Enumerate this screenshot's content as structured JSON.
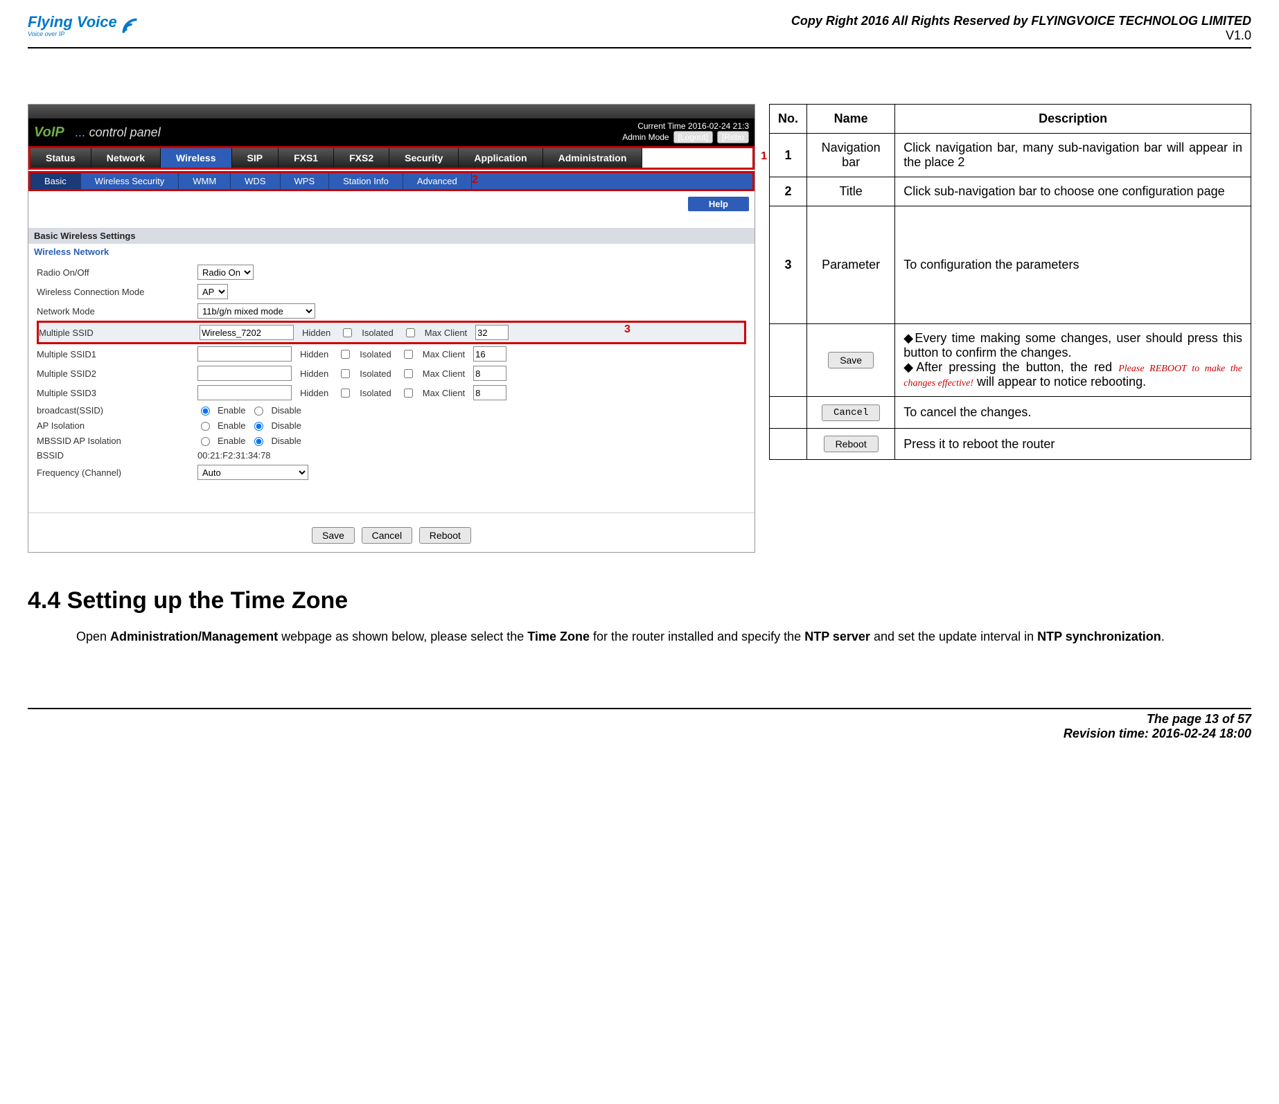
{
  "header": {
    "logo_text": "Flying Voice",
    "logo_sub": "Voice over IP",
    "copyright": "Copy Right 2016 All Rights Reserved by FLYINGVOICE TECHNOLOG LIMITED",
    "version": "V1.0"
  },
  "router": {
    "voip_label": "VoIP",
    "control_panel": "control panel",
    "current_time_label": "Current Time",
    "current_time_value": "2016-02-24 21:3",
    "admin_mode": "Admin Mode",
    "logout": "[Logout]",
    "reboot_top": "[Rebo",
    "nav1": [
      "Status",
      "Network",
      "Wireless",
      "SIP",
      "FXS1",
      "FXS2",
      "Security",
      "Application",
      "Administration"
    ],
    "nav1_active": "Wireless",
    "nav2": [
      "Basic",
      "Wireless Security",
      "WMM",
      "WDS",
      "WPS",
      "Station Info",
      "Advanced"
    ],
    "nav2_active": "Basic",
    "help": "Help",
    "section_title": "Basic Wireless Settings",
    "section_sub": "Wireless Network",
    "markers": {
      "m1": "1",
      "m2": "2",
      "m3": "3"
    },
    "fields": {
      "radio_label": "Radio On/Off",
      "radio_sel": "Radio On",
      "wcm_label": "Wireless Connection Mode",
      "wcm_sel": "AP",
      "nm_label": "Network Mode",
      "nm_sel": "11b/g/n mixed mode",
      "mssid_label": "Multiple SSID",
      "mssid_val": "Wireless_7202",
      "hidden": "Hidden",
      "isolated": "Isolated",
      "maxclient": "Max Client",
      "mssid_mc": "32",
      "mssid1_label": "Multiple SSID1",
      "mssid1_mc": "16",
      "mssid2_label": "Multiple SSID2",
      "mssid2_mc": "8",
      "mssid3_label": "Multiple SSID3",
      "mssid3_mc": "8",
      "broadcast_label": "broadcast(SSID)",
      "enable": "Enable",
      "disable": "Disable",
      "apiso_label": "AP Isolation",
      "mbssid_label": "MBSSID AP Isolation",
      "bssid_label": "BSSID",
      "bssid_val": "00:21:F2:31:34:78",
      "freq_label": "Frequency (Channel)",
      "freq_sel": "Auto"
    },
    "footer": {
      "save": "Save",
      "cancel": "Cancel",
      "reboot": "Reboot"
    }
  },
  "desc_table": {
    "hdr_no": "No.",
    "hdr_name": "Name",
    "hdr_desc": "Description",
    "r1_no": "1",
    "r1_name": "Navigation bar",
    "r1_desc": "Click navigation bar, many sub-navigation bar will appear in the place 2",
    "r2_no": "2",
    "r2_name": "Title",
    "r2_desc": "Click sub-navigation bar to choose one configuration page",
    "r3_no": "3",
    "r3_name": "Parameter",
    "r3_desc": "To configuration the parameters",
    "r4_btn": "Save",
    "r4_d1": "Every time making some changes, user should press this button to confirm the changes.",
    "r4_d2a": "After pressing the button, the red",
    "r4_red": "Please REBOOT to make the changes effective!",
    "r4_d2b": "will appear to notice rebooting.",
    "r5_btn": "Cancel",
    "r5_desc": "To cancel the changes.",
    "r6_btn": "Reboot",
    "r6_desc": "Press it to reboot the router"
  },
  "section": {
    "heading": "4.4 Setting up the Time Zone",
    "body_a": "Open ",
    "body_b": "Administration/Management",
    "body_c": " webpage as shown below, please select the ",
    "body_d": "Time Zone",
    "body_e": " for the router installed and specify the ",
    "body_f": "NTP server",
    "body_g": " and set the update interval in ",
    "body_h": "NTP synchronization",
    "body_i": "."
  },
  "footer": {
    "page": "The page 13 of 57",
    "revision": "Revision time: 2016-02-24 18:00"
  }
}
